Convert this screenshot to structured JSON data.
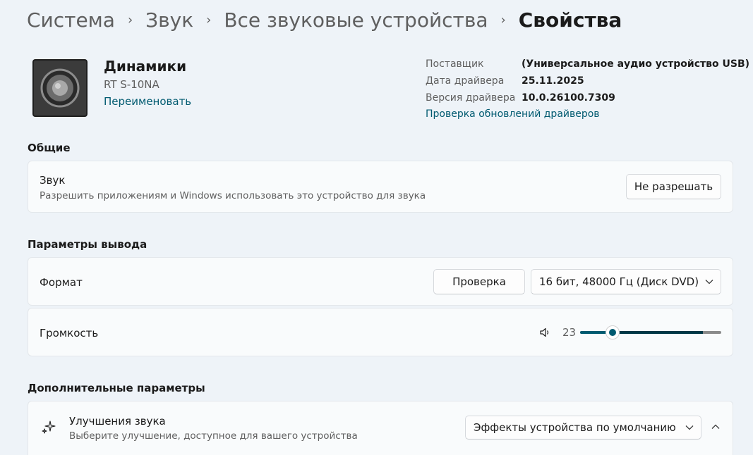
{
  "breadcrumb": {
    "items": [
      "Система",
      "Звук",
      "Все звуковые устройства"
    ],
    "current": "Свойства"
  },
  "device": {
    "icon": "speaker-icon",
    "name": "Динамики",
    "model": "RT S-10NA",
    "rename_label": "Переименовать"
  },
  "driver": {
    "rows": [
      {
        "key": "Поставщик",
        "value": "(Универсальное аудио устройство USB)"
      },
      {
        "key": "Дата драйвера",
        "value": "25.11.2025"
      },
      {
        "key": "Версия драйвера",
        "value": "10.0.26100.7309"
      }
    ],
    "update_link": "Проверка обновлений драйверов"
  },
  "general": {
    "title": "Общие",
    "sound": {
      "title": "Звук",
      "desc": "Разрешить приложениям и Windows использовать это устройство для звука",
      "button": "Не разрешать"
    }
  },
  "output": {
    "title": "Параметры вывода",
    "format": {
      "label": "Формат",
      "test_button": "Проверка",
      "selected": "16 бит, 48000 Гц (Диск DVD)"
    },
    "volume": {
      "label": "Громкость",
      "value": "23",
      "percent": 23,
      "level_bar_percent": 87
    }
  },
  "advanced": {
    "title": "Дополнительные параметры",
    "enhancements": {
      "title": "Улучшения звука",
      "desc": "Выберите улучшение, доступное для вашего устройства",
      "selected": "Эффекты устройства по умолчанию"
    }
  },
  "colors": {
    "accent": "#005a70",
    "background": "#eef3f8",
    "card": "#f9fbfc"
  }
}
